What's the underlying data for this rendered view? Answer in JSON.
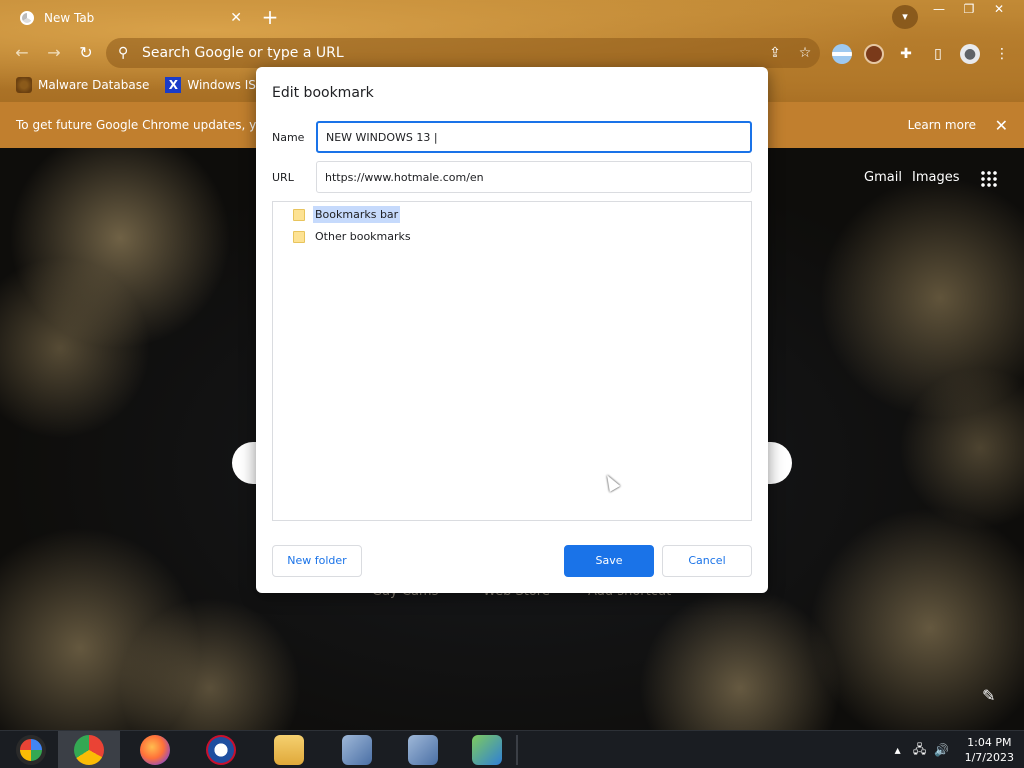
{
  "tab": {
    "title": "New Tab",
    "close": "✕"
  },
  "toolbar": {
    "omnibox_placeholder": "Search Google or type a URL"
  },
  "window_controls": [
    "—",
    "❐",
    "✕"
  ],
  "bookmarks_bar": [
    {
      "label": "Malware Database",
      "icon": "malware-icon"
    },
    {
      "label": "Windows ISOs",
      "icon": "x-icon"
    }
  ],
  "info_bar": {
    "text": "To get future Google Chrome updates, you'",
    "learn_more": "Learn more",
    "close": "✕"
  },
  "ntp": {
    "gmail": "Gmail",
    "images": "Images",
    "shortcuts": [
      "Gay Cams",
      "Web Store",
      "Add shortcut"
    ]
  },
  "dialog": {
    "title": "Edit bookmark",
    "name_label": "Name",
    "name_value": "NEW WINDOWS 13 |",
    "url_label": "URL",
    "url_value": "https://www.hotmale.com/en",
    "folders": [
      {
        "label": "Bookmarks bar",
        "selected": true
      },
      {
        "label": "Other bookmarks",
        "selected": false
      }
    ],
    "new_folder_label": "New folder",
    "save_label": "Save",
    "cancel_label": "Cancel"
  },
  "taskbar": {
    "time": "1:04 PM",
    "date": "1/7/2023"
  },
  "colors": {
    "accent": "#1a73e8",
    "info_bar": "#c17f2e",
    "selection": "#c6dafc"
  }
}
